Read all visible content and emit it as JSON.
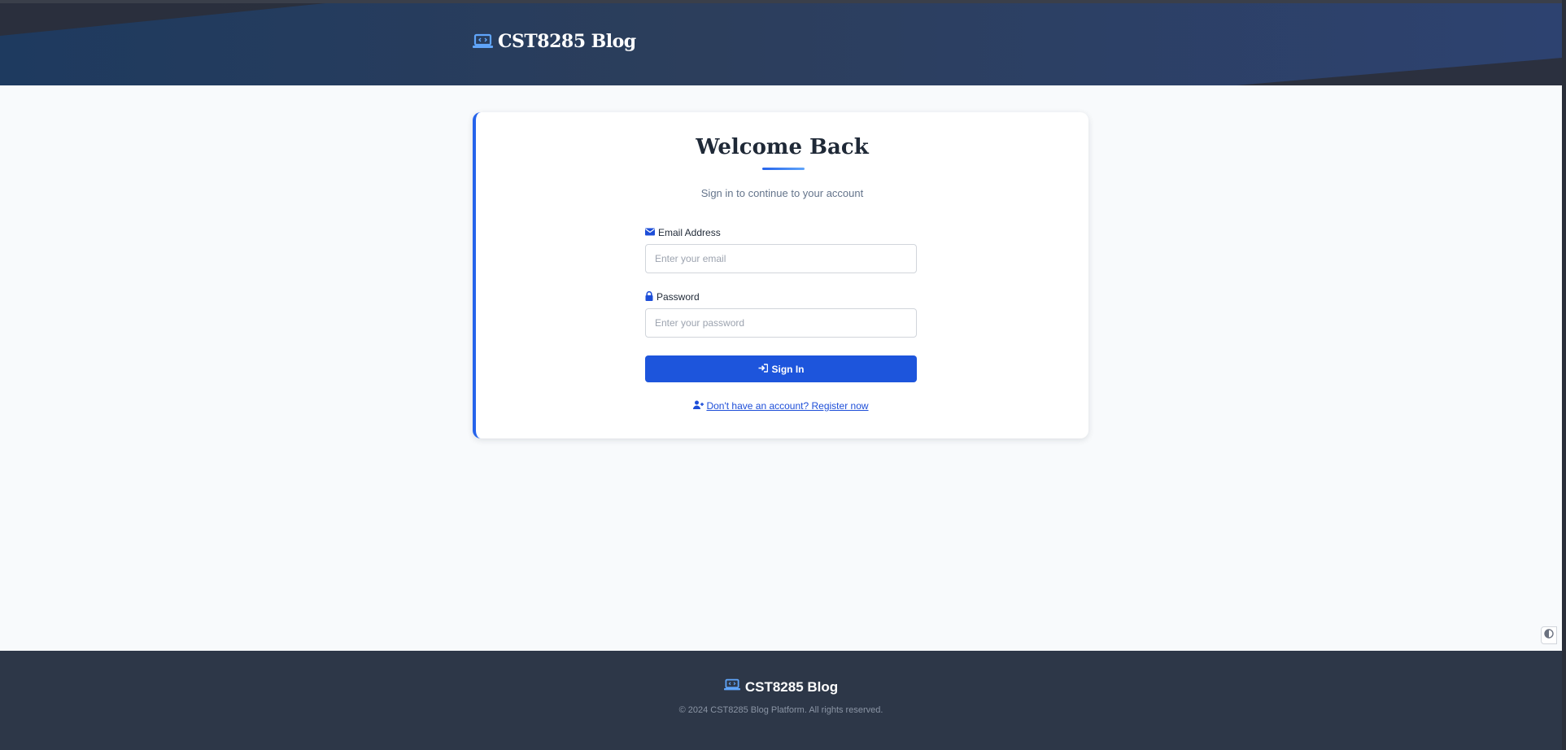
{
  "header": {
    "brand": "CST8285 Blog"
  },
  "login": {
    "title": "Welcome Back",
    "subtitle": "Sign in to continue to your account",
    "email_label": "Email Address",
    "email_value": "",
    "email_placeholder": "Enter your email",
    "password_label": "Password",
    "password_value": "",
    "password_placeholder": "Enter your password",
    "submit_label": "Sign In",
    "register_link": "Don't have an account? Register now"
  },
  "footer": {
    "brand": "CST8285 Blog",
    "copyright": "© 2024 CST8285 Blog Platform. All rights reserved."
  },
  "icons": {
    "brand": "laptop-code-icon",
    "email": "envelope-icon",
    "password": "lock-icon",
    "submit": "sign-in-icon",
    "register": "user-plus-icon",
    "widget": "circle-half-icon"
  },
  "colors": {
    "accent": "#1d55dc",
    "brand_icon": "#60a5fa",
    "footer_bg": "#2d3748"
  }
}
